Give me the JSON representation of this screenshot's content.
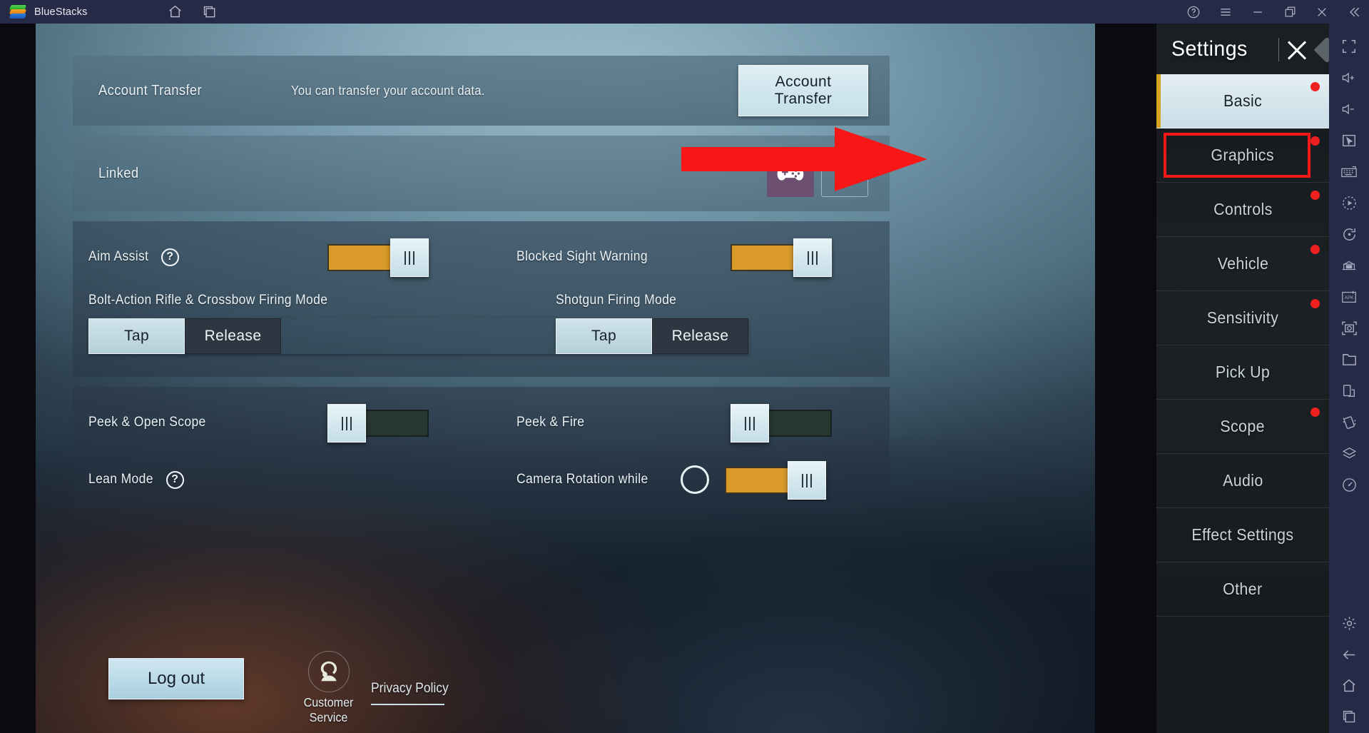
{
  "window": {
    "app_name": "BlueStacks",
    "titlebar_icons": [
      "home-icon",
      "multi-instance-icon"
    ],
    "titlebar_right_icons": [
      "help-icon",
      "menu-icon",
      "minimize-icon",
      "maximize-icon",
      "close-icon",
      "collapse-icon"
    ]
  },
  "bs_sidebar": {
    "icons": [
      "fullscreen-icon",
      "volume-up-icon",
      "volume-down-icon",
      "cursor-icon",
      "keyboard-icon",
      "macro-play-icon",
      "rotate-icon",
      "eco-mode-icon",
      "install-apk-icon",
      "screenshot-icon",
      "media-folder-icon",
      "multi-instance-icon",
      "shake-icon",
      "layers-icon",
      "gps-icon",
      "settings-gear-icon",
      "back-icon",
      "home-icon",
      "recents-icon"
    ]
  },
  "game": {
    "rows": {
      "account_transfer": {
        "label": "Account Transfer",
        "description": "You can transfer your account data.",
        "button": "Account Transfer"
      },
      "linked": {
        "label": "Linked",
        "linked_icon": "gamepad-icon",
        "add_icon": "plus-icon"
      },
      "aim_assist": {
        "label": "Aim Assist",
        "help_icon": "question-mark-icon",
        "toggle_state": "on"
      },
      "blocked_sight_warning": {
        "label": "Blocked Sight Warning",
        "toggle_state": "on"
      },
      "bolt_action": {
        "label": "Bolt-Action Rifle & Crossbow Firing Mode",
        "options": [
          "Tap",
          "Release"
        ],
        "selected": "Tap"
      },
      "shotgun": {
        "label": "Shotgun Firing Mode",
        "options": [
          "Tap",
          "Release"
        ],
        "selected": "Tap"
      },
      "peek_open_scope": {
        "label": "Peek & Open Scope",
        "toggle_state": "off"
      },
      "peek_fire": {
        "label": "Peek & Fire",
        "toggle_state": "off"
      },
      "lean_mode": {
        "label": "Lean Mode",
        "help_icon": "question-mark-icon"
      },
      "camera_rotation": {
        "label": "Camera Rotation while",
        "toggle_state": "on"
      }
    },
    "footer": {
      "logout": "Log out",
      "customer_service": "Customer Service",
      "customer_service_icon": "headset-support-icon",
      "privacy_policy": "Privacy Policy"
    }
  },
  "settings_panel": {
    "title": "Settings",
    "close_icon": "close-x-icon",
    "items": [
      {
        "label": "Basic",
        "active": true,
        "dot": true,
        "highlight": false
      },
      {
        "label": "Graphics",
        "active": false,
        "dot": true,
        "highlight": true
      },
      {
        "label": "Controls",
        "active": false,
        "dot": true,
        "highlight": false
      },
      {
        "label": "Vehicle",
        "active": false,
        "dot": true,
        "highlight": false
      },
      {
        "label": "Sensitivity",
        "active": false,
        "dot": true,
        "highlight": false
      },
      {
        "label": "Pick Up",
        "active": false,
        "dot": false,
        "highlight": false
      },
      {
        "label": "Scope",
        "active": false,
        "dot": true,
        "highlight": false
      },
      {
        "label": "Audio",
        "active": false,
        "dot": false,
        "highlight": false
      },
      {
        "label": "Effect Settings",
        "active": false,
        "dot": false,
        "highlight": false
      },
      {
        "label": "Other",
        "active": false,
        "dot": false,
        "highlight": false
      }
    ]
  },
  "annotation": {
    "arrow_color": "#f71717",
    "highlight_color": "#f71717",
    "target": "Graphics"
  }
}
